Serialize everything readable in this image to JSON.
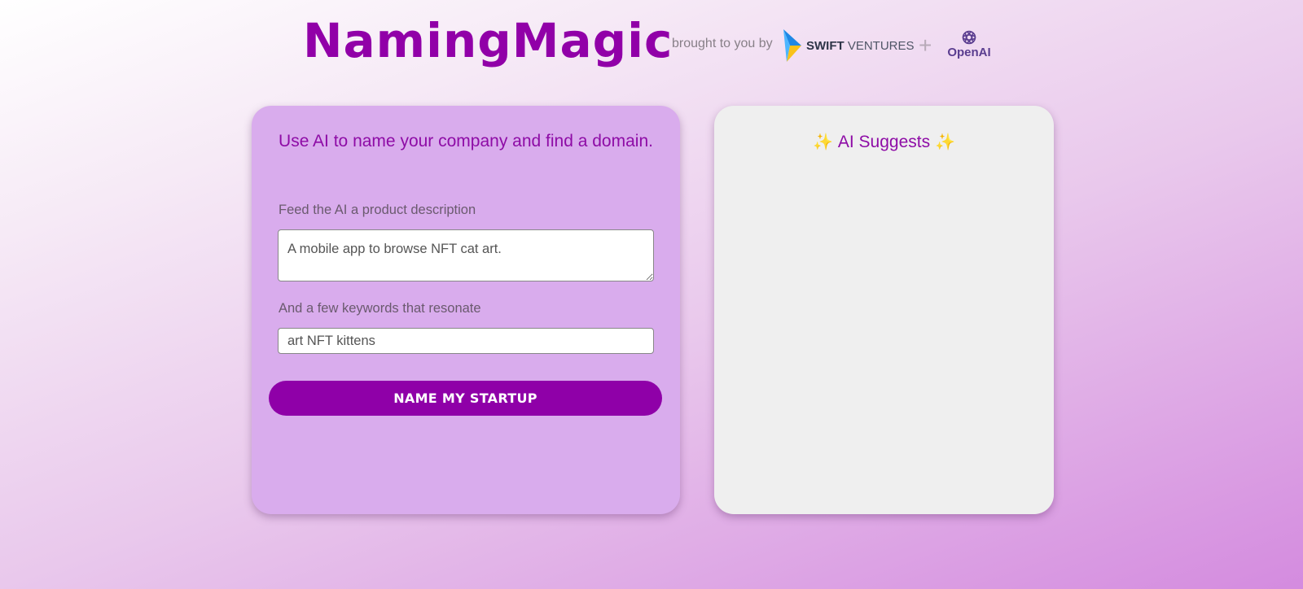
{
  "header": {
    "title": "NamingMagic",
    "brought_by": "brought to you by",
    "sponsor": {
      "bold": "SWIFT",
      "rest": " VENTURES"
    },
    "plus": "+",
    "partner": "OpenAI"
  },
  "form": {
    "heading": "Use AI to name your company and find a domain.",
    "description_label": "Feed the AI a product description",
    "description_value": "A mobile app to browse NFT cat art.",
    "keywords_label": "And a few keywords that resonate",
    "keywords_value": "art NFT kittens",
    "submit_label": "NAME MY STARTUP"
  },
  "results": {
    "heading": "AI Suggests",
    "sparkle": "✨"
  },
  "colors": {
    "accent": "#8f00a8",
    "card_left": "#d9aced",
    "card_right": "#efefef"
  }
}
